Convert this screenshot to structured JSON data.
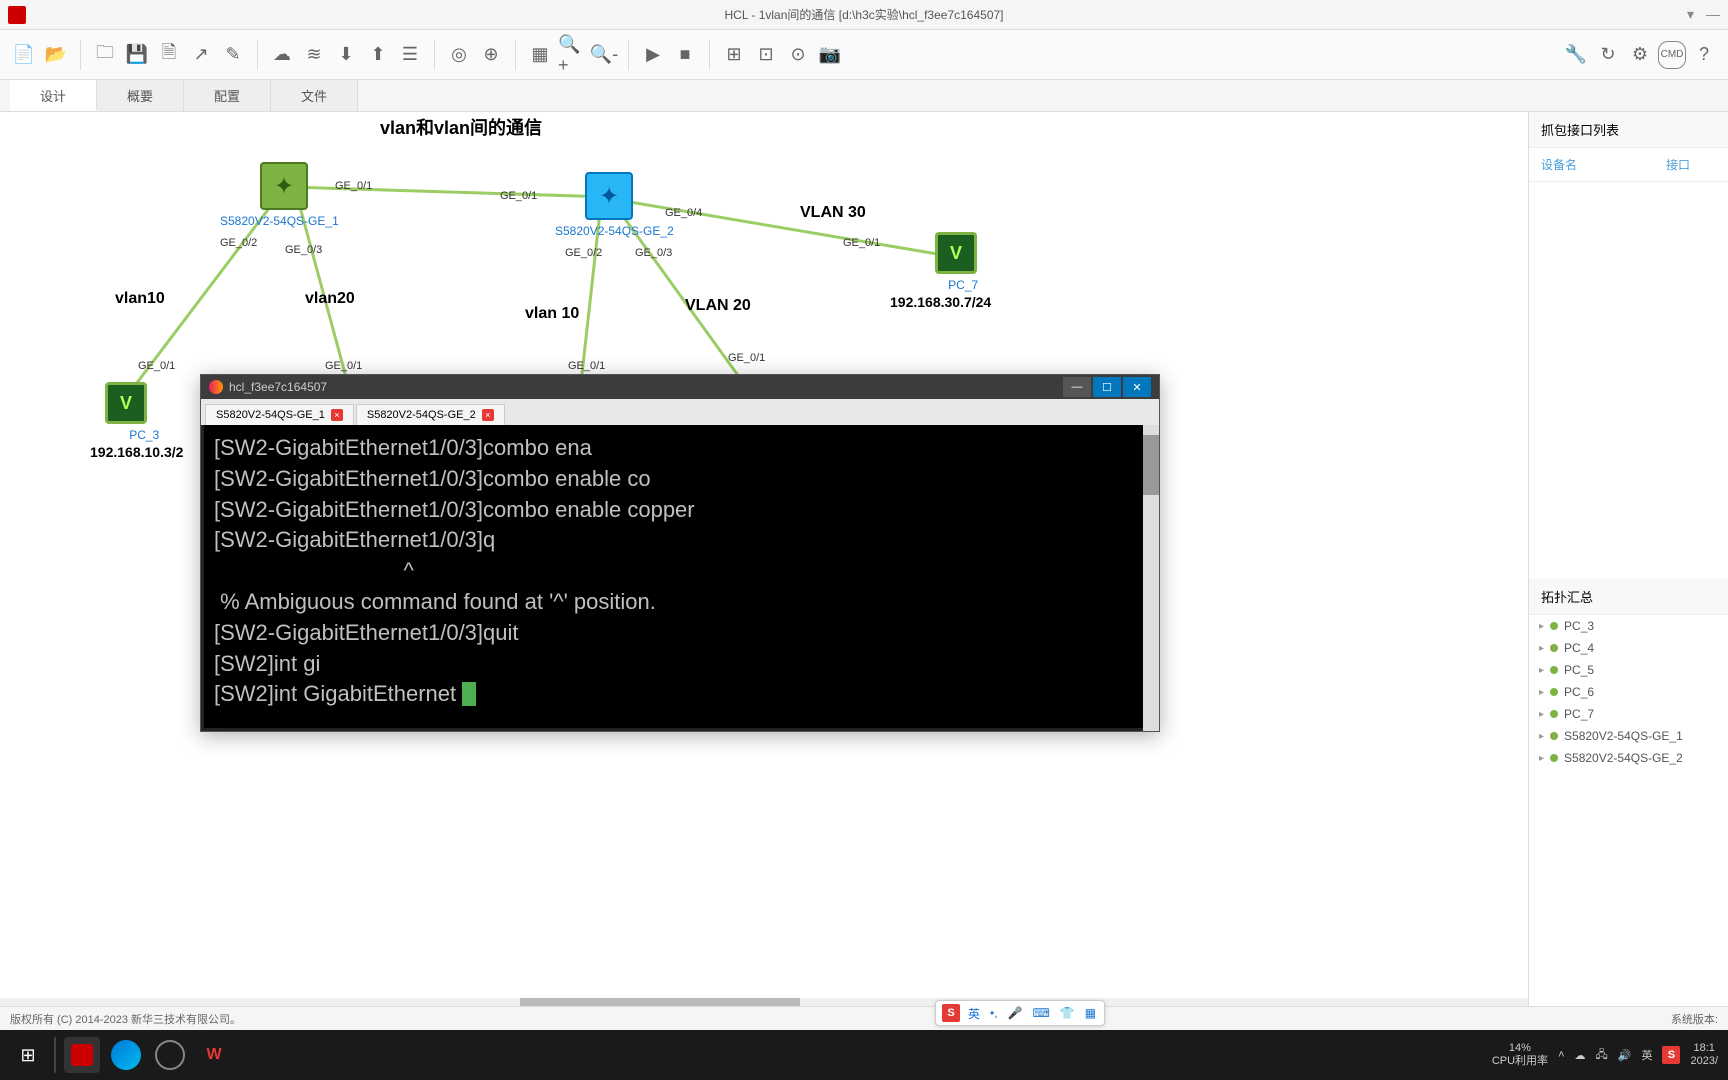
{
  "window": {
    "title": "HCL - 1vlan间的通信 [d:\\h3c实验\\hcl_f3ee7c164507]"
  },
  "tabs": {
    "design": "设计",
    "overview": "概要",
    "config": "配置",
    "file": "文件"
  },
  "canvas": {
    "title": "vlan和vlan间的通信",
    "nodes": {
      "sw1": {
        "label": "S5820V2-54QS-GE_1"
      },
      "sw2": {
        "label": "S5820V2-54QS-GE_2"
      },
      "pc3": {
        "label": "PC_3",
        "ip": "192.168.10.3/2"
      },
      "pc7": {
        "label": "PC_7",
        "ip": "192.168.30.7/24"
      }
    },
    "ports": {
      "p1": "GE_0/1",
      "p2": "GE_0/2",
      "p3": "GE_0/3",
      "p4": "GE_0/4"
    },
    "vlans": {
      "v10a": "vlan10",
      "v20a": "vlan20",
      "v10b": "vlan 10",
      "v20b": "VLAN 20",
      "v30": "VLAN 30"
    }
  },
  "terminal": {
    "title": "hcl_f3ee7c164507",
    "tabs": [
      "S5820V2-54QS-GE_1",
      "S5820V2-54QS-GE_2"
    ],
    "lines": [
      "[SW2-GigabitEthernet1/0/3]combo ena",
      "[SW2-GigabitEthernet1/0/3]combo enable co",
      "[SW2-GigabitEthernet1/0/3]combo enable copper",
      "[SW2-GigabitEthernet1/0/3]q",
      "                               ^",
      " % Ambiguous command found at '^' position.",
      "[SW2-GigabitEthernet1/0/3]quit",
      "[SW2]int gi",
      "[SW2]int GigabitEthernet "
    ]
  },
  "sidebar": {
    "capture_header": "抓包接口列表",
    "col_device": "设备名",
    "col_iface": "接口",
    "topo_header": "拓扑汇总",
    "items": [
      "PC_3",
      "PC_4",
      "PC_5",
      "PC_6",
      "PC_7",
      "S5820V2-54QS-GE_1",
      "S5820V2-54QS-GE_2"
    ]
  },
  "statusbar": {
    "copyright": "版权所有 (C) 2014-2023 新华三技术有限公司。",
    "version": "系统版本:"
  },
  "ime": {
    "lang": "英"
  },
  "taskbar": {
    "cpu_pct": "14%",
    "cpu_label": "CPU利用率",
    "tray_lang": "英",
    "time": "18:1",
    "date": "2023/"
  }
}
